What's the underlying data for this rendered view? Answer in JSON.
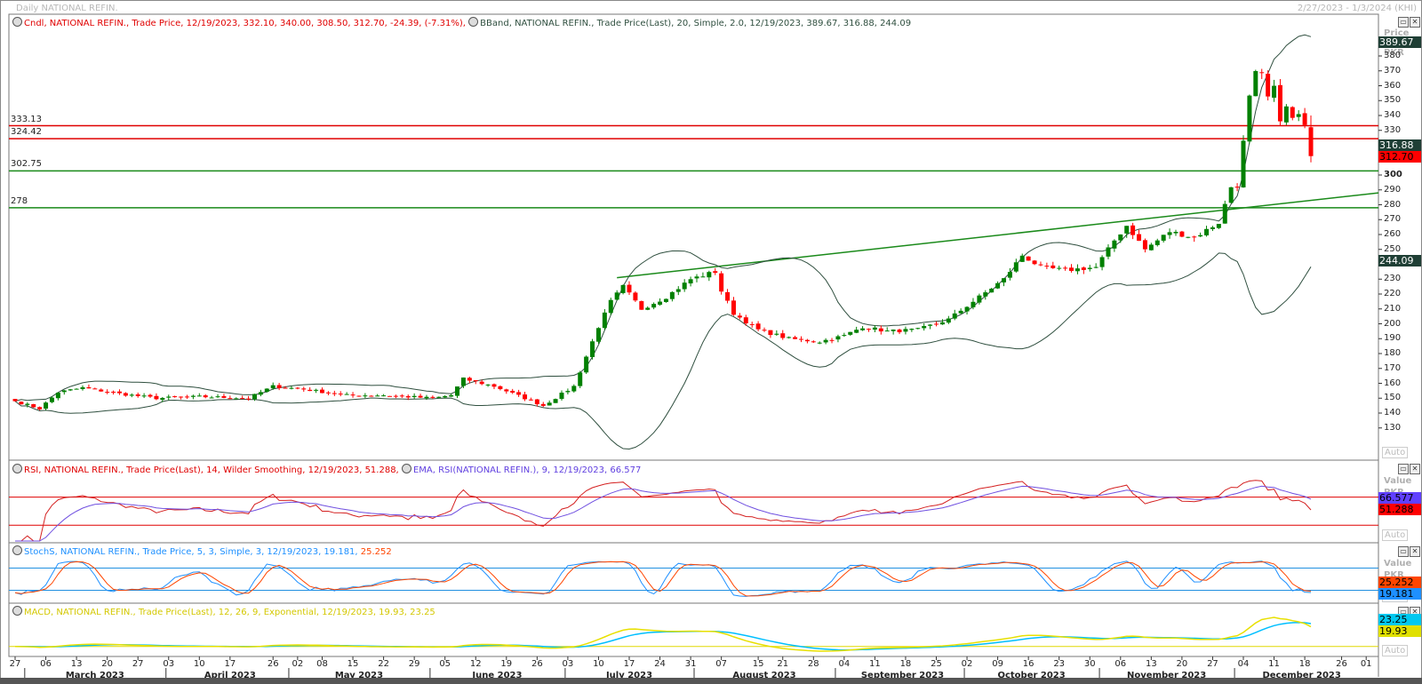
{
  "window": {
    "title": "Daily NATIONAL REFIN.",
    "range": "2/27/2023 - 1/3/2024 (KHI)"
  },
  "legends": {
    "candle": "Cndl, NATIONAL REFIN., Trade Price, 12/19/2023, 332.10, 340.00, 308.50, 312.70, -24.39, (-7.31%),",
    "bband": "BBand, NATIONAL REFIN., Trade Price(Last), 20, Simple, 2.0, 12/19/2023, 389.67, 316.88, 244.09",
    "rsi": "RSI, NATIONAL REFIN., Trade Price(Last), 14, Wilder Smoothing, 12/19/2023, 51.288,",
    "ema": "EMA, RSI(NATIONAL REFIN.), 9, 12/19/2023, 66.577",
    "stoch": "StochS, NATIONAL REFIN., Trade Price, 5, 3, Simple, 3, 12/19/2023, 19.181,",
    "stoch2": "25.252",
    "macd": "MACD, NATIONAL REFIN., Trade Price(Last), 12, 26, 9, Exponential, 12/19/2023, 19.93, 23.25"
  },
  "colors": {
    "up": "#008000",
    "down": "#ff0000",
    "band": "#2f4f3f",
    "rsi": "#d42020",
    "ema": "#7050e0",
    "stochK": "#1e90ff",
    "stochD": "#ff4500",
    "macd": "#e8e000",
    "signal": "#00bfff",
    "hline_red": "#e00000",
    "hline_green": "#1a8a1a"
  },
  "chart_data": {
    "type": "candlestick",
    "ylim": [
      120,
      392
    ],
    "y_ticks": [
      130,
      140,
      150,
      160,
      170,
      180,
      190,
      200,
      210,
      220,
      230,
      240,
      250,
      260,
      270,
      280,
      290,
      300,
      310,
      320,
      330,
      340,
      350,
      360,
      370,
      380
    ],
    "price_unit": "Price PKR",
    "last_candle": {
      "date": "2023-12-19",
      "open": 332.1,
      "high": 340.0,
      "low": 308.5,
      "close": 312.7,
      "change": -24.39,
      "change_pct": -7.31
    },
    "close_path": [
      [
        "2023-02-27",
        148
      ],
      [
        "2023-03-03",
        143
      ],
      [
        "2023-03-08",
        154
      ],
      [
        "2023-03-14",
        157
      ],
      [
        "2023-03-22",
        153
      ],
      [
        "2023-03-30",
        150
      ],
      [
        "2023-04-10",
        151
      ],
      [
        "2023-04-20",
        150
      ],
      [
        "2023-04-26",
        158
      ],
      [
        "2023-05-03",
        156
      ],
      [
        "2023-05-12",
        152
      ],
      [
        "2023-05-22",
        152
      ],
      [
        "2023-06-01",
        150
      ],
      [
        "2023-06-06",
        152
      ],
      [
        "2023-06-08",
        163
      ],
      [
        "2023-06-15",
        158
      ],
      [
        "2023-06-22",
        150
      ],
      [
        "2023-06-27",
        145
      ],
      [
        "2023-07-04",
        158
      ],
      [
        "2023-07-06",
        178
      ],
      [
        "2023-07-10",
        198
      ],
      [
        "2023-07-12",
        215
      ],
      [
        "2023-07-14",
        225
      ],
      [
        "2023-07-19",
        210
      ],
      [
        "2023-07-25",
        218
      ],
      [
        "2023-07-31",
        230
      ],
      [
        "2023-08-04",
        235
      ],
      [
        "2023-08-07",
        222
      ],
      [
        "2023-08-09",
        207
      ],
      [
        "2023-08-15",
        196
      ],
      [
        "2023-08-22",
        190
      ],
      [
        "2023-08-29",
        188
      ],
      [
        "2023-09-04",
        192
      ],
      [
        "2023-09-07",
        198
      ],
      [
        "2023-09-13",
        195
      ],
      [
        "2023-09-20",
        196
      ],
      [
        "2023-09-27",
        203
      ],
      [
        "2023-10-04",
        218
      ],
      [
        "2023-10-10",
        230
      ],
      [
        "2023-10-13",
        246
      ],
      [
        "2023-10-18",
        238
      ],
      [
        "2023-10-24",
        236
      ],
      [
        "2023-10-31",
        238
      ],
      [
        "2023-11-03",
        256
      ],
      [
        "2023-11-07",
        266
      ],
      [
        "2023-11-10",
        250
      ],
      [
        "2023-11-16",
        262
      ],
      [
        "2023-11-22",
        258
      ],
      [
        "2023-11-28",
        268
      ],
      [
        "2023-11-30",
        292
      ],
      [
        "2023-12-01",
        293
      ],
      [
        "2023-12-04",
        322
      ],
      [
        "2023-12-05",
        352
      ],
      [
        "2023-12-06",
        368
      ],
      [
        "2023-12-07",
        367
      ],
      [
        "2023-12-08",
        352
      ],
      [
        "2023-12-11",
        358
      ],
      [
        "2023-12-12",
        338
      ],
      [
        "2023-12-13",
        345
      ],
      [
        "2023-12-14",
        338
      ],
      [
        "2023-12-15",
        340
      ],
      [
        "2023-12-18",
        332
      ],
      [
        "2023-12-19",
        312.7
      ]
    ],
    "horizontal_lines": [
      {
        "value": 333.13,
        "label": "333.13",
        "color": "red"
      },
      {
        "value": 324.42,
        "label": "324.42",
        "color": "red"
      },
      {
        "value": 302.75,
        "label": "302.75",
        "color": "green"
      },
      {
        "value": 278,
        "label": "278",
        "color": "green"
      }
    ],
    "trendline": {
      "from": [
        "2023-07-13",
        231
      ],
      "to": [
        "2024-01-03",
        288
      ]
    },
    "bband": {
      "period": 20,
      "stddev": 2.0,
      "upper": 389.67,
      "middle": 316.88,
      "lower": 244.09
    },
    "rsi": {
      "period": 14,
      "value": 51.288,
      "ema_period": 9,
      "ema_value": 66.577,
      "levels": [
        70,
        30
      ],
      "ylim": [
        10,
        100
      ],
      "tick": "40"
    },
    "stoch": {
      "k": 19.181,
      "d": 25.252,
      "levels": [
        80,
        20
      ],
      "ylim": [
        -10,
        110
      ]
    },
    "macd": {
      "macd": 19.93,
      "signal": 23.25
    },
    "x_ticks": [
      "2023-02-27",
      "2023-03-06",
      "2023-03-13",
      "2023-03-20",
      "2023-03-27",
      "2023-04-03",
      "2023-04-10",
      "2023-04-17",
      "2023-04-26",
      "2023-05-02",
      "2023-05-08",
      "2023-05-15",
      "2023-05-22",
      "2023-05-29",
      "2023-06-05",
      "2023-06-12",
      "2023-06-19",
      "2023-06-26",
      "2023-07-03",
      "2023-07-10",
      "2023-07-17",
      "2023-07-24",
      "2023-07-31",
      "2023-08-07",
      "2023-08-15",
      "2023-08-21",
      "2023-08-28",
      "2023-09-04",
      "2023-09-11",
      "2023-09-18",
      "2023-09-25",
      "2023-10-02",
      "2023-10-09",
      "2023-10-16",
      "2023-10-23",
      "2023-10-30",
      "2023-11-06",
      "2023-11-13",
      "2023-11-20",
      "2023-11-27",
      "2023-12-04",
      "2023-12-11",
      "2023-12-18",
      "2023-12-26",
      "2024-01-01"
    ],
    "x_tick_labels": [
      "27",
      "06",
      "13",
      "20",
      "27",
      "03",
      "10",
      "17",
      "26",
      "02",
      "08",
      "15",
      "22",
      "29",
      "05",
      "12",
      "19",
      "26",
      "03",
      "10",
      "17",
      "24",
      "31",
      "07",
      "15",
      "21",
      "28",
      "04",
      "11",
      "18",
      "25",
      "02",
      "09",
      "16",
      "23",
      "30",
      "06",
      "13",
      "20",
      "27",
      "04",
      "11",
      "18",
      "26",
      "01"
    ],
    "months": [
      {
        "label": "March 2023",
        "start": "2023-03-01",
        "end": "2023-03-31"
      },
      {
        "label": "April 2023",
        "start": "2023-04-01",
        "end": "2023-04-30"
      },
      {
        "label": "May 2023",
        "start": "2023-05-01",
        "end": "2023-05-31"
      },
      {
        "label": "June 2023",
        "start": "2023-06-01",
        "end": "2023-06-30"
      },
      {
        "label": "July 2023",
        "start": "2023-07-01",
        "end": "2023-07-31"
      },
      {
        "label": "August 2023",
        "start": "2023-08-01",
        "end": "2023-08-31"
      },
      {
        "label": "September 2023",
        "start": "2023-09-01",
        "end": "2023-09-30"
      },
      {
        "label": "October 2023",
        "start": "2023-10-01",
        "end": "2023-10-31"
      },
      {
        "label": "November 2023",
        "start": "2023-11-01",
        "end": "2023-11-30"
      },
      {
        "label": "December 2023",
        "start": "2023-12-01",
        "end": "2023-12-31"
      }
    ]
  },
  "axis": {
    "auto": "Auto",
    "value": "Value",
    "pkr": "PKR",
    "price": "Price",
    "rsi_box_ema": "66.577",
    "rsi_box_rsi": "51.288",
    "stoch_box_d": "25.252",
    "stoch_box_k": "19.181",
    "macd_box_signal": "23.25",
    "macd_box_macd": "19.93",
    "price_box_upper": "389.67",
    "price_box_mid": "316.88",
    "price_box_last": "312.70",
    "price_box_lower": "244.09"
  }
}
